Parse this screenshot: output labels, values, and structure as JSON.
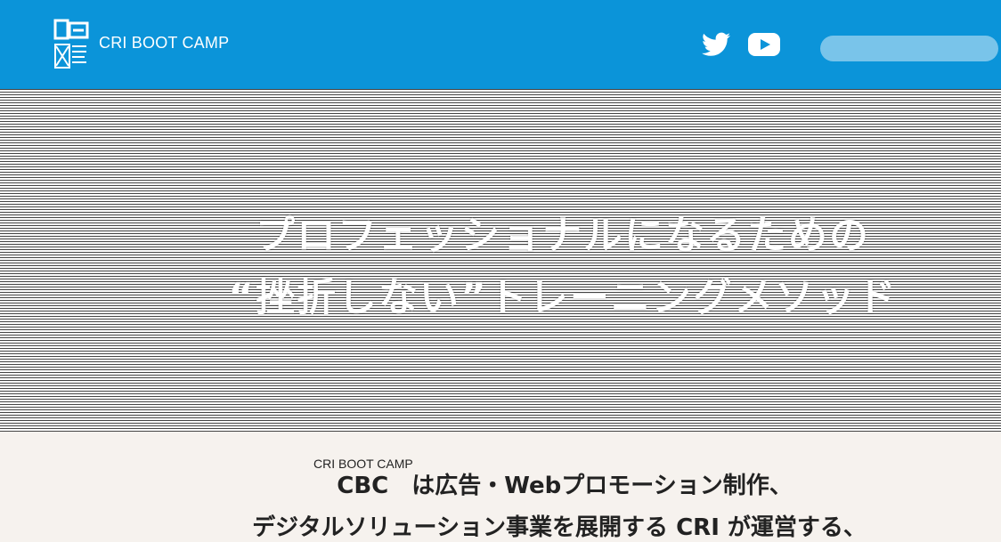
{
  "header": {
    "brand": "CRI BOOT CAMP",
    "search_placeholder": "",
    "colors": {
      "background": "#0b94d9",
      "text": "#ffffff"
    },
    "icons": [
      "cbc-logo-icon",
      "twitter-icon",
      "youtube-icon"
    ]
  },
  "hero": {
    "line1": "プロフェッショナルになるための",
    "line2": "“挫折しない”トレーニングメソッド"
  },
  "intro": {
    "ruby": "CRI BOOT CAMP",
    "line1": "CBC　は広告・Webプロモーション制作、",
    "line2": "デジタルソリューション事業を展開する CRI が運営する、"
  }
}
